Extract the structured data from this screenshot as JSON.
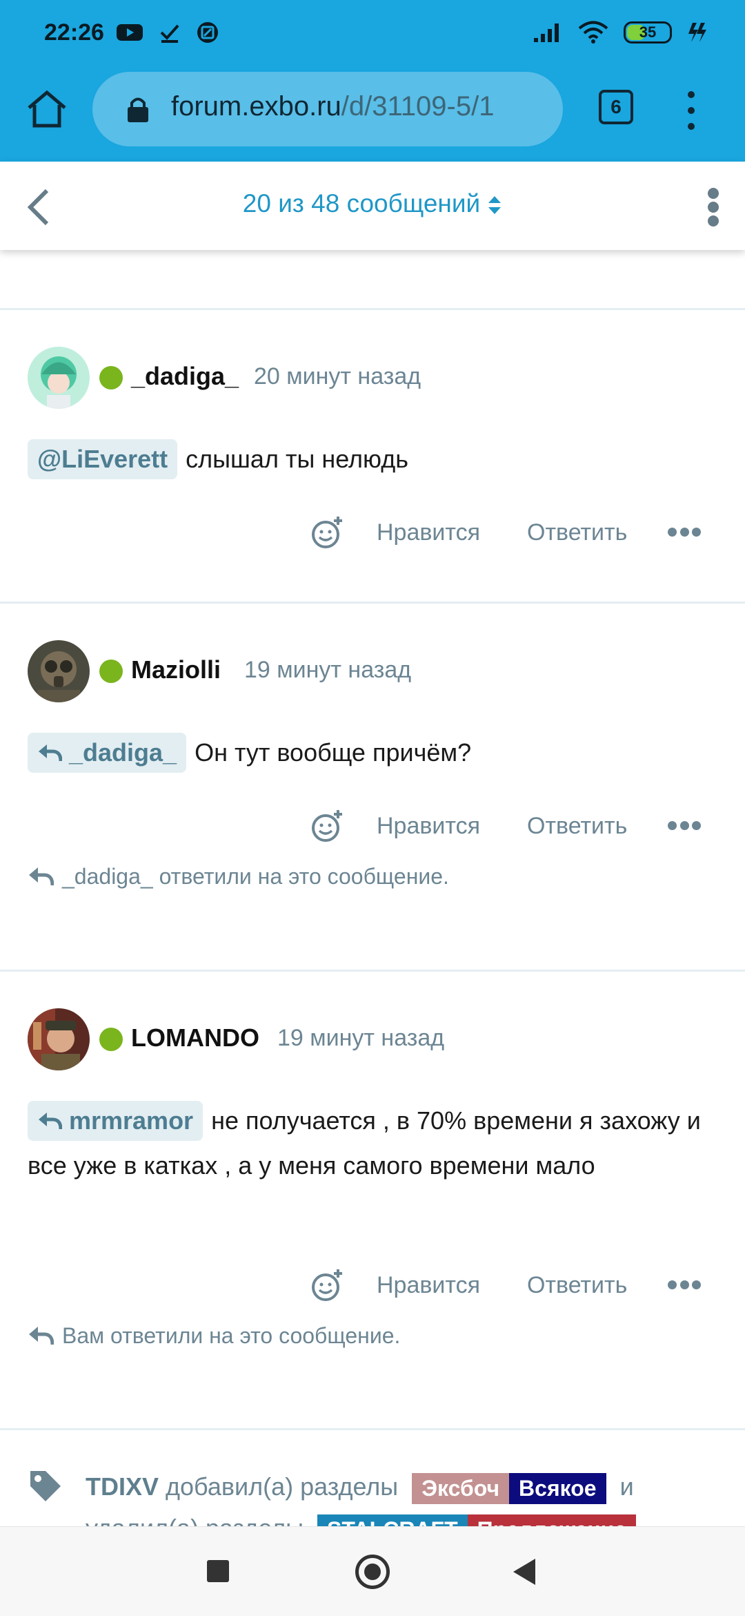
{
  "status_bar": {
    "time": "22:26",
    "battery": "35"
  },
  "browser": {
    "url_host": "forum.exbo.ru",
    "url_path": "/d/31109-5/1",
    "tab_count": "6"
  },
  "forum_header": {
    "counter": "20 из 48 сообщений"
  },
  "posts": [
    {
      "username": "_dadiga_",
      "time": "20 минут назад",
      "mention": "@LiEverett",
      "text": "слышал ты нелюдь",
      "like_label": "Нравится",
      "reply_label": "Ответить"
    },
    {
      "username": "Maziolli",
      "time": "19 минут назад",
      "mention": "_dadiga_",
      "text": "Он тут вообще причём?",
      "like_label": "Нравится",
      "reply_label": "Ответить",
      "replied_note": "_dadiga_ ответили на это сообщение."
    },
    {
      "username": "LOMANDO",
      "time": "19 минут назад",
      "mention": "mrmramor",
      "text": "не получается , в 70% времени я захожу и все уже в катках , а у меня самого времени мало",
      "like_label": "Нравится",
      "reply_label": "Ответить",
      "replied_note": "Вам ответили на это сообщение."
    }
  ],
  "event": {
    "user": "TDIXV",
    "added_text": "добавил(а) разделы",
    "and_text": "и",
    "removed_text": "удалил(а) разделы",
    "added_tags": [
      {
        "label": "Эксбоч",
        "color": "#c39191"
      },
      {
        "label": "Всякое",
        "color": "#0c0c7e"
      }
    ],
    "removed_tags": [
      {
        "label": "STALCRAFT",
        "color": "#1a86b8"
      },
      {
        "label": "Предложение",
        "color": "#b8313b"
      }
    ]
  },
  "colors": {
    "brand_bar": "#1aa6df",
    "accent": "#1f97c7",
    "online": "#7ab51d",
    "muted_text": "#6c8593"
  }
}
